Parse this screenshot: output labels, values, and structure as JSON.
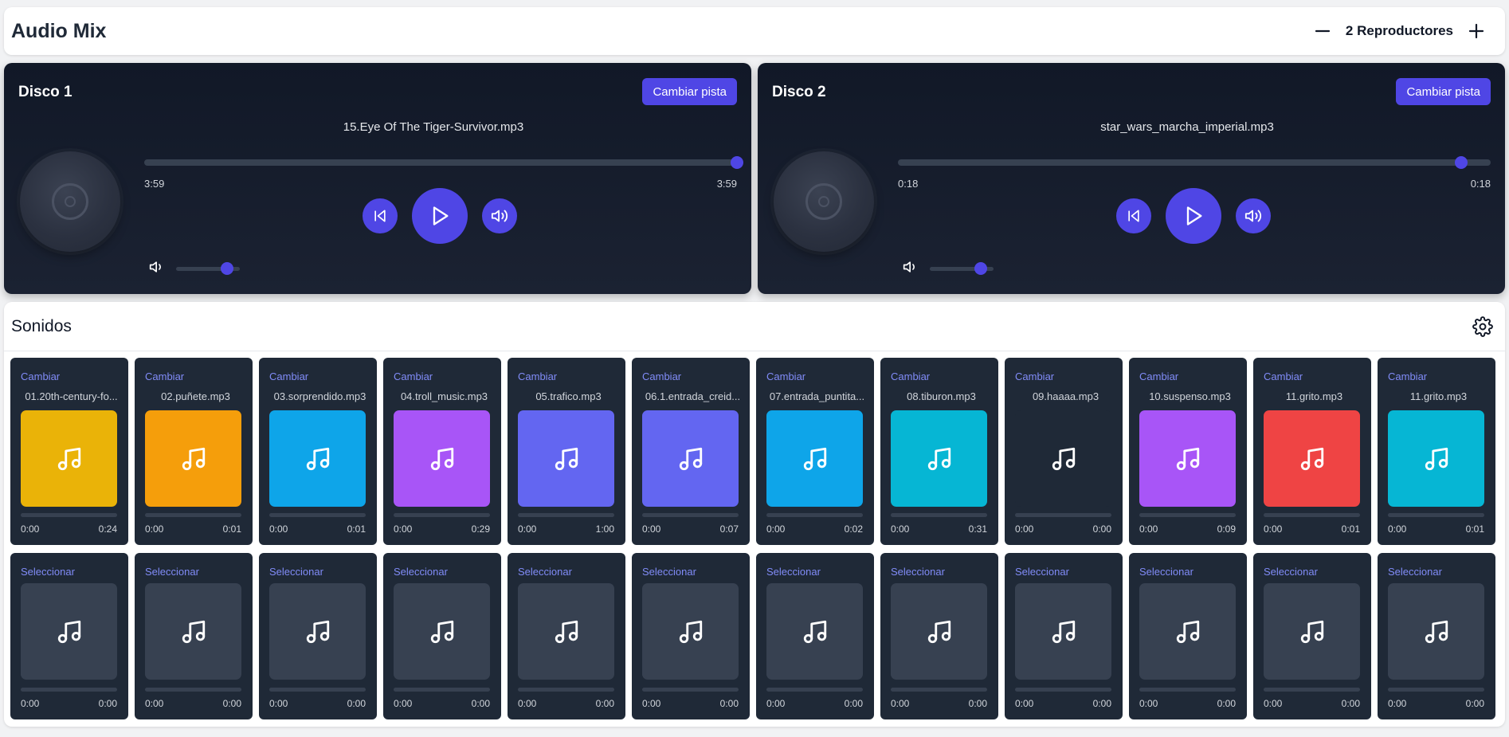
{
  "header": {
    "title": "Audio Mix",
    "player_count_label": "2 Reproductores"
  },
  "players": [
    {
      "title": "Disco 1",
      "change_label": "Cambiar pista",
      "track": "15.Eye Of The Tiger-Survivor.mp3",
      "current_time": "3:59",
      "duration": "3:59",
      "progress": 1.0,
      "volume": 0.8
    },
    {
      "title": "Disco 2",
      "change_label": "Cambiar pista",
      "track": "star_wars_marcha_imperial.mp3",
      "current_time": "0:18",
      "duration": "0:18",
      "progress": 0.95,
      "volume": 0.8
    }
  ],
  "sounds": {
    "title": "Sonidos",
    "top_row": [
      {
        "action": "Cambiar",
        "file": "01.20th-century-fo...",
        "color": "#eab308",
        "start": "0:00",
        "end": "0:24"
      },
      {
        "action": "Cambiar",
        "file": "02.puñete.mp3",
        "color": "#f59e0b",
        "start": "0:00",
        "end": "0:01"
      },
      {
        "action": "Cambiar",
        "file": "03.sorprendido.mp3",
        "color": "#0ea5e9",
        "start": "0:00",
        "end": "0:01"
      },
      {
        "action": "Cambiar",
        "file": "04.troll_music.mp3",
        "color": "#a855f7",
        "start": "0:00",
        "end": "0:29"
      },
      {
        "action": "Cambiar",
        "file": "05.trafico.mp3",
        "color": "#6366f1",
        "start": "0:00",
        "end": "1:00"
      },
      {
        "action": "Cambiar",
        "file": "06.1.entrada_creid...",
        "color": "#6366f1",
        "start": "0:00",
        "end": "0:07"
      },
      {
        "action": "Cambiar",
        "file": "07.entrada_puntita...",
        "color": "#0ea5e9",
        "start": "0:00",
        "end": "0:02"
      },
      {
        "action": "Cambiar",
        "file": "08.tiburon.mp3",
        "color": "#06b6d4",
        "start": "0:00",
        "end": "0:31"
      },
      {
        "action": "Cambiar",
        "file": "09.haaaa.mp3",
        "color": "#1f2937",
        "start": "0:00",
        "end": "0:00"
      },
      {
        "action": "Cambiar",
        "file": "10.suspenso.mp3",
        "color": "#a855f7",
        "start": "0:00",
        "end": "0:09"
      },
      {
        "action": "Cambiar",
        "file": "11.grito.mp3",
        "color": "#ef4444",
        "start": "0:00",
        "end": "0:01"
      },
      {
        "action": "Cambiar",
        "file": "11.grito.mp3",
        "color": "#06b6d4",
        "start": "0:00",
        "end": "0:01"
      }
    ],
    "bottom_row": [
      {
        "action": "Seleccionar",
        "start": "0:00",
        "end": "0:00"
      },
      {
        "action": "Seleccionar",
        "start": "0:00",
        "end": "0:00"
      },
      {
        "action": "Seleccionar",
        "start": "0:00",
        "end": "0:00"
      },
      {
        "action": "Seleccionar",
        "start": "0:00",
        "end": "0:00"
      },
      {
        "action": "Seleccionar",
        "start": "0:00",
        "end": "0:00"
      },
      {
        "action": "Seleccionar",
        "start": "0:00",
        "end": "0:00"
      },
      {
        "action": "Seleccionar",
        "start": "0:00",
        "end": "0:00"
      },
      {
        "action": "Seleccionar",
        "start": "0:00",
        "end": "0:00"
      },
      {
        "action": "Seleccionar",
        "start": "0:00",
        "end": "0:00"
      },
      {
        "action": "Seleccionar",
        "start": "0:00",
        "end": "0:00"
      },
      {
        "action": "Seleccionar",
        "start": "0:00",
        "end": "0:00"
      },
      {
        "action": "Seleccionar",
        "start": "0:00",
        "end": "0:00"
      }
    ]
  },
  "colors": {
    "accent": "#4f46e5",
    "card_bg": "#1f2937",
    "link": "#818cf8"
  },
  "icons": [
    "minus-icon",
    "plus-icon",
    "skip-back-icon",
    "play-icon",
    "volume-icon",
    "music-note-icon",
    "gear-icon",
    "vinyl-icon"
  ]
}
